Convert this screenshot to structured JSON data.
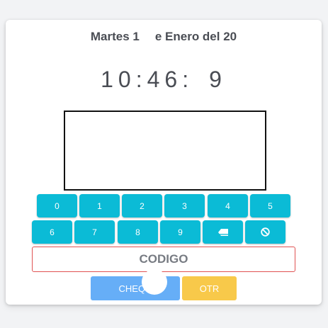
{
  "header": {
    "date_left": "Martes 1",
    "date_right": "e Enero del 20"
  },
  "clock": {
    "time_left": "10:46:",
    "time_right": "9"
  },
  "keypad": {
    "row1": [
      "0",
      "1",
      "2",
      "3",
      "4",
      "5"
    ],
    "row2": [
      "6",
      "7",
      "8",
      "9"
    ],
    "backspace_icon": "eraser-icon",
    "clear_icon": "cancel-circle-icon",
    "key_color": "#0bbbd6"
  },
  "code_field": {
    "placeholder": "CODIGO",
    "border_color": "#e05252"
  },
  "actions": {
    "check_label": "CHEQU",
    "other_label": "OTR",
    "check_color": "#66aef7",
    "other_color": "#f8c94a"
  }
}
